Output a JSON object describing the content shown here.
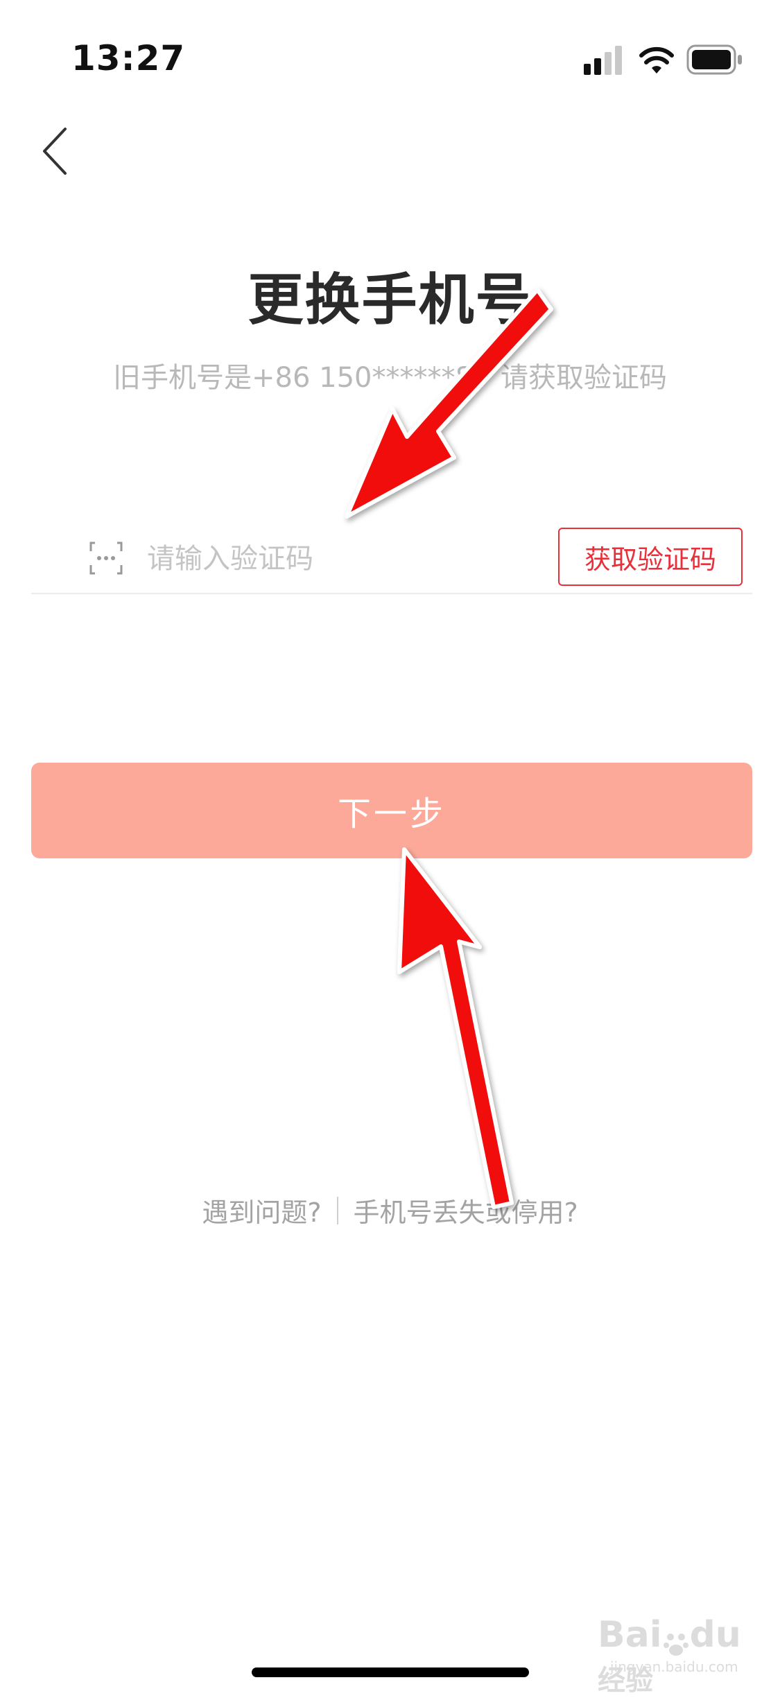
{
  "status_bar": {
    "time": "13:27"
  },
  "header": {
    "back_icon": "chevron-left-icon"
  },
  "title": "更换手机号",
  "subtitle": "旧手机号是+86 150******8，请获取验证码",
  "code_field": {
    "placeholder": "请输入验证码",
    "icon": "dots-box-icon",
    "value": ""
  },
  "get_code_button": {
    "label": "获取验证码"
  },
  "next_button": {
    "label": "下一步"
  },
  "help": {
    "problem_link": "遇到问题?",
    "lost_phone_link": "手机号丢失或停用?"
  },
  "watermark": {
    "brand": "Bai",
    "brand2": "du",
    "suffix": "经验",
    "url": "jingyan.baidu.com"
  },
  "colors": {
    "accent": "#e8303a",
    "button_disabled": "#fca99a",
    "annotation_arrow": "#f20d0d"
  }
}
